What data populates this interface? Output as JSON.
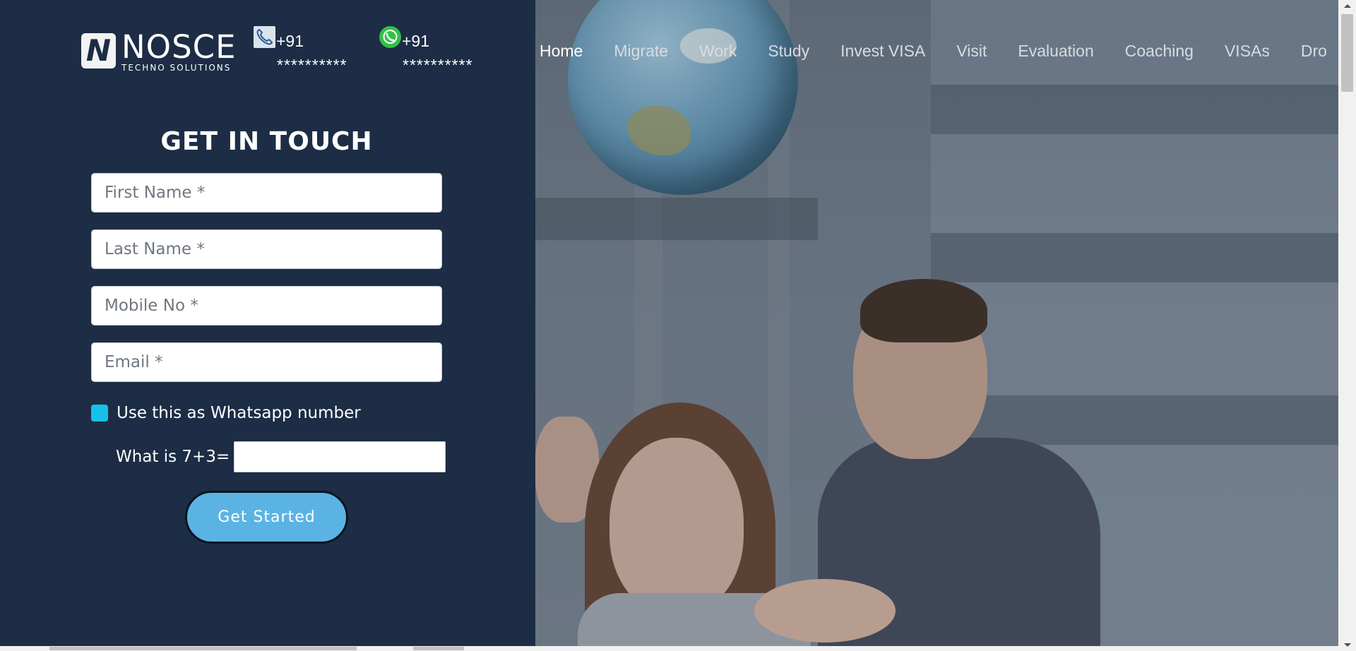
{
  "brand": {
    "logo_mark": "N",
    "name": "NOSCE",
    "subtitle": "TECHNO SOLUTIONS"
  },
  "contacts": [
    {
      "icon": "phone-icon",
      "code": "+91",
      "number": "**********"
    },
    {
      "icon": "whatsapp-icon",
      "code": "+91",
      "number": "**********"
    }
  ],
  "nav": {
    "items": [
      {
        "label": "Home",
        "active": true
      },
      {
        "label": "Migrate"
      },
      {
        "label": "Work"
      },
      {
        "label": "Study"
      },
      {
        "label": "Invest VISA"
      },
      {
        "label": "Visit"
      },
      {
        "label": "Evaluation"
      },
      {
        "label": "Coaching"
      },
      {
        "label": "VISAs"
      },
      {
        "label": "Dro"
      }
    ]
  },
  "form": {
    "title": "GET IN TOUCH",
    "first_name_placeholder": "First Name *",
    "last_name_placeholder": "Last Name *",
    "mobile_placeholder": "Mobile No *",
    "email_placeholder": "Email *",
    "whatsapp_label": "Use this as Whatsapp number",
    "captcha_label": "What is 7+3=",
    "submit_label": "Get Started"
  },
  "colors": {
    "panel_bg": "#1c2d45",
    "button_bg": "#5bb3e3",
    "checkbox": "#17c0ea"
  }
}
